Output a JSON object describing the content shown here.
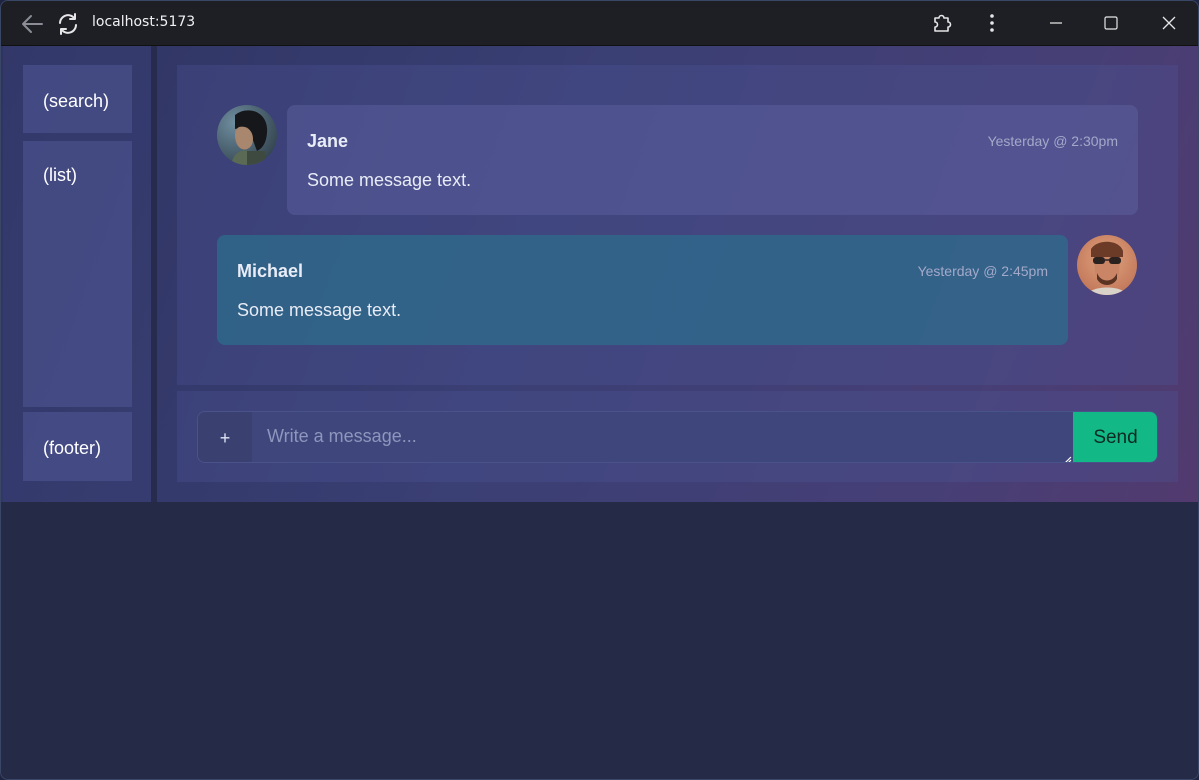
{
  "browser": {
    "url": "localhost:5173"
  },
  "sidebar": {
    "search_label": "(search)",
    "list_label": "(list)",
    "footer_label": "(footer)"
  },
  "messages": [
    {
      "author": "Jane",
      "time": "Yesterday @ 2:30pm",
      "text": "Some message text.",
      "avatar": "woman-portrait"
    },
    {
      "author": "Michael",
      "time": "Yesterday @ 2:45pm",
      "text": "Some message text.",
      "avatar": "man-sunglasses-portrait"
    }
  ],
  "composer": {
    "attach_label": "+",
    "placeholder": "Write a message...",
    "send_label": "Send"
  },
  "colors": {
    "send_button": "#12b886",
    "own_bubble": "#2d6e8c",
    "other_bubble": "#5f64a5"
  }
}
